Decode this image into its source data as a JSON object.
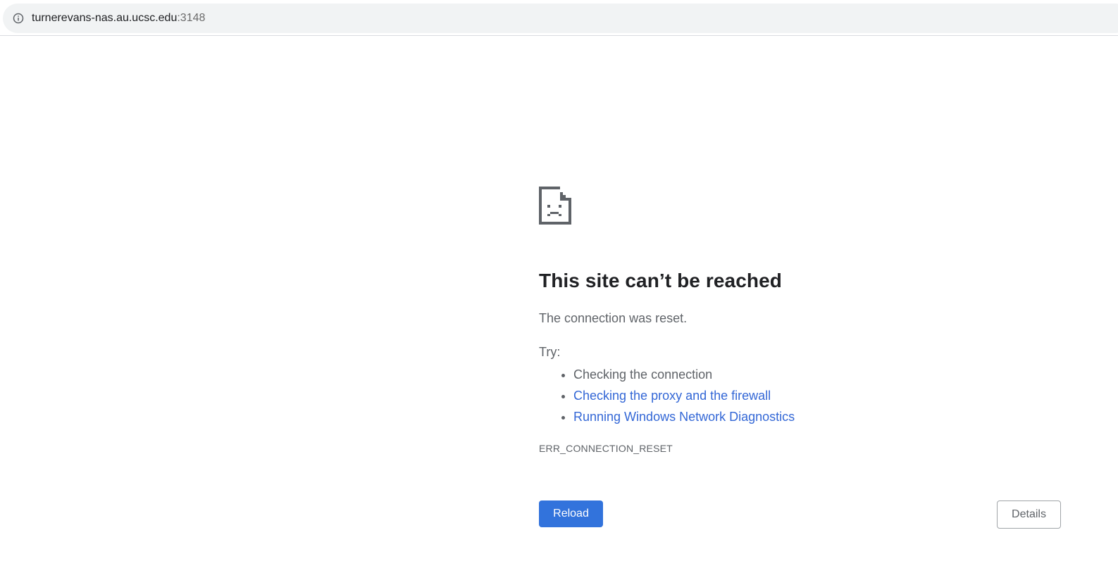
{
  "omnibox": {
    "icon": "info-icon",
    "host": "turnerevans-nas.au.ucsc.edu",
    "port": ":3148"
  },
  "error_page": {
    "icon": "sad-page-icon",
    "title": "This site can’t be reached",
    "description": "The connection was reset.",
    "try_label": "Try:",
    "suggestions": [
      {
        "label": "Checking the connection",
        "link": false
      },
      {
        "label": "Checking the proxy and the firewall",
        "link": true
      },
      {
        "label": "Running Windows Network Diagnostics",
        "link": true
      }
    ],
    "error_code": "ERR_CONNECTION_RESET"
  },
  "buttons": {
    "reload_label": "Reload",
    "details_label": "Details"
  },
  "colors": {
    "link": "#3367d6",
    "primary_button": "#3273dc",
    "text_secondary": "#5f6368",
    "title": "#202124"
  }
}
